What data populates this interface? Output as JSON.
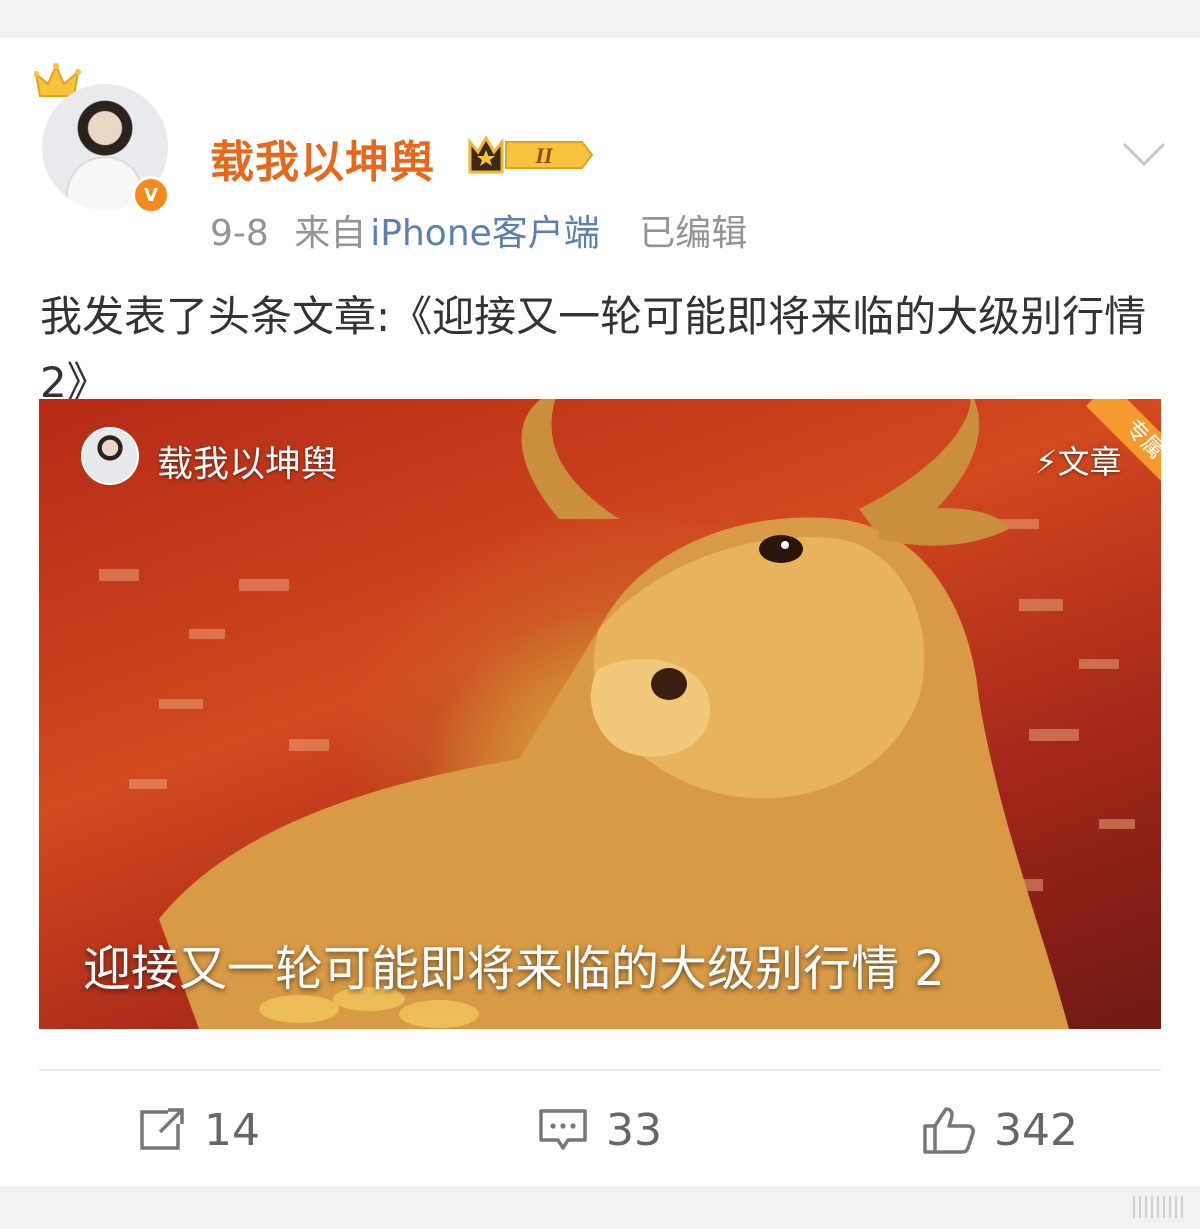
{
  "post": {
    "username": "载我以坤舆",
    "date": "9-8",
    "from_label": "来自",
    "source": "iPhone客户端",
    "edited": "已编辑",
    "text": "我发表了头条文章:《迎接又一轮可能即将来临的大级别行情2》",
    "badge_level": "II"
  },
  "article_card": {
    "author": "载我以坤舆",
    "type_label": "文章",
    "corner_label": "专属",
    "title": "迎接又一轮可能即将来临的大级别行情 2"
  },
  "actions": {
    "repost_count": "14",
    "comment_count": "33",
    "like_count": "342"
  },
  "icons": {
    "crown": "crown-icon",
    "verified": "verified-v-icon",
    "more": "chevron-down-icon",
    "lightning": "lightning-icon",
    "repost": "repost-icon",
    "comment": "comment-icon",
    "like": "thumbs-up-icon"
  },
  "colors": {
    "username": "#e8671b",
    "source_link": "#5b7fae",
    "verified": "#f58b1f",
    "meta": "#939393"
  }
}
